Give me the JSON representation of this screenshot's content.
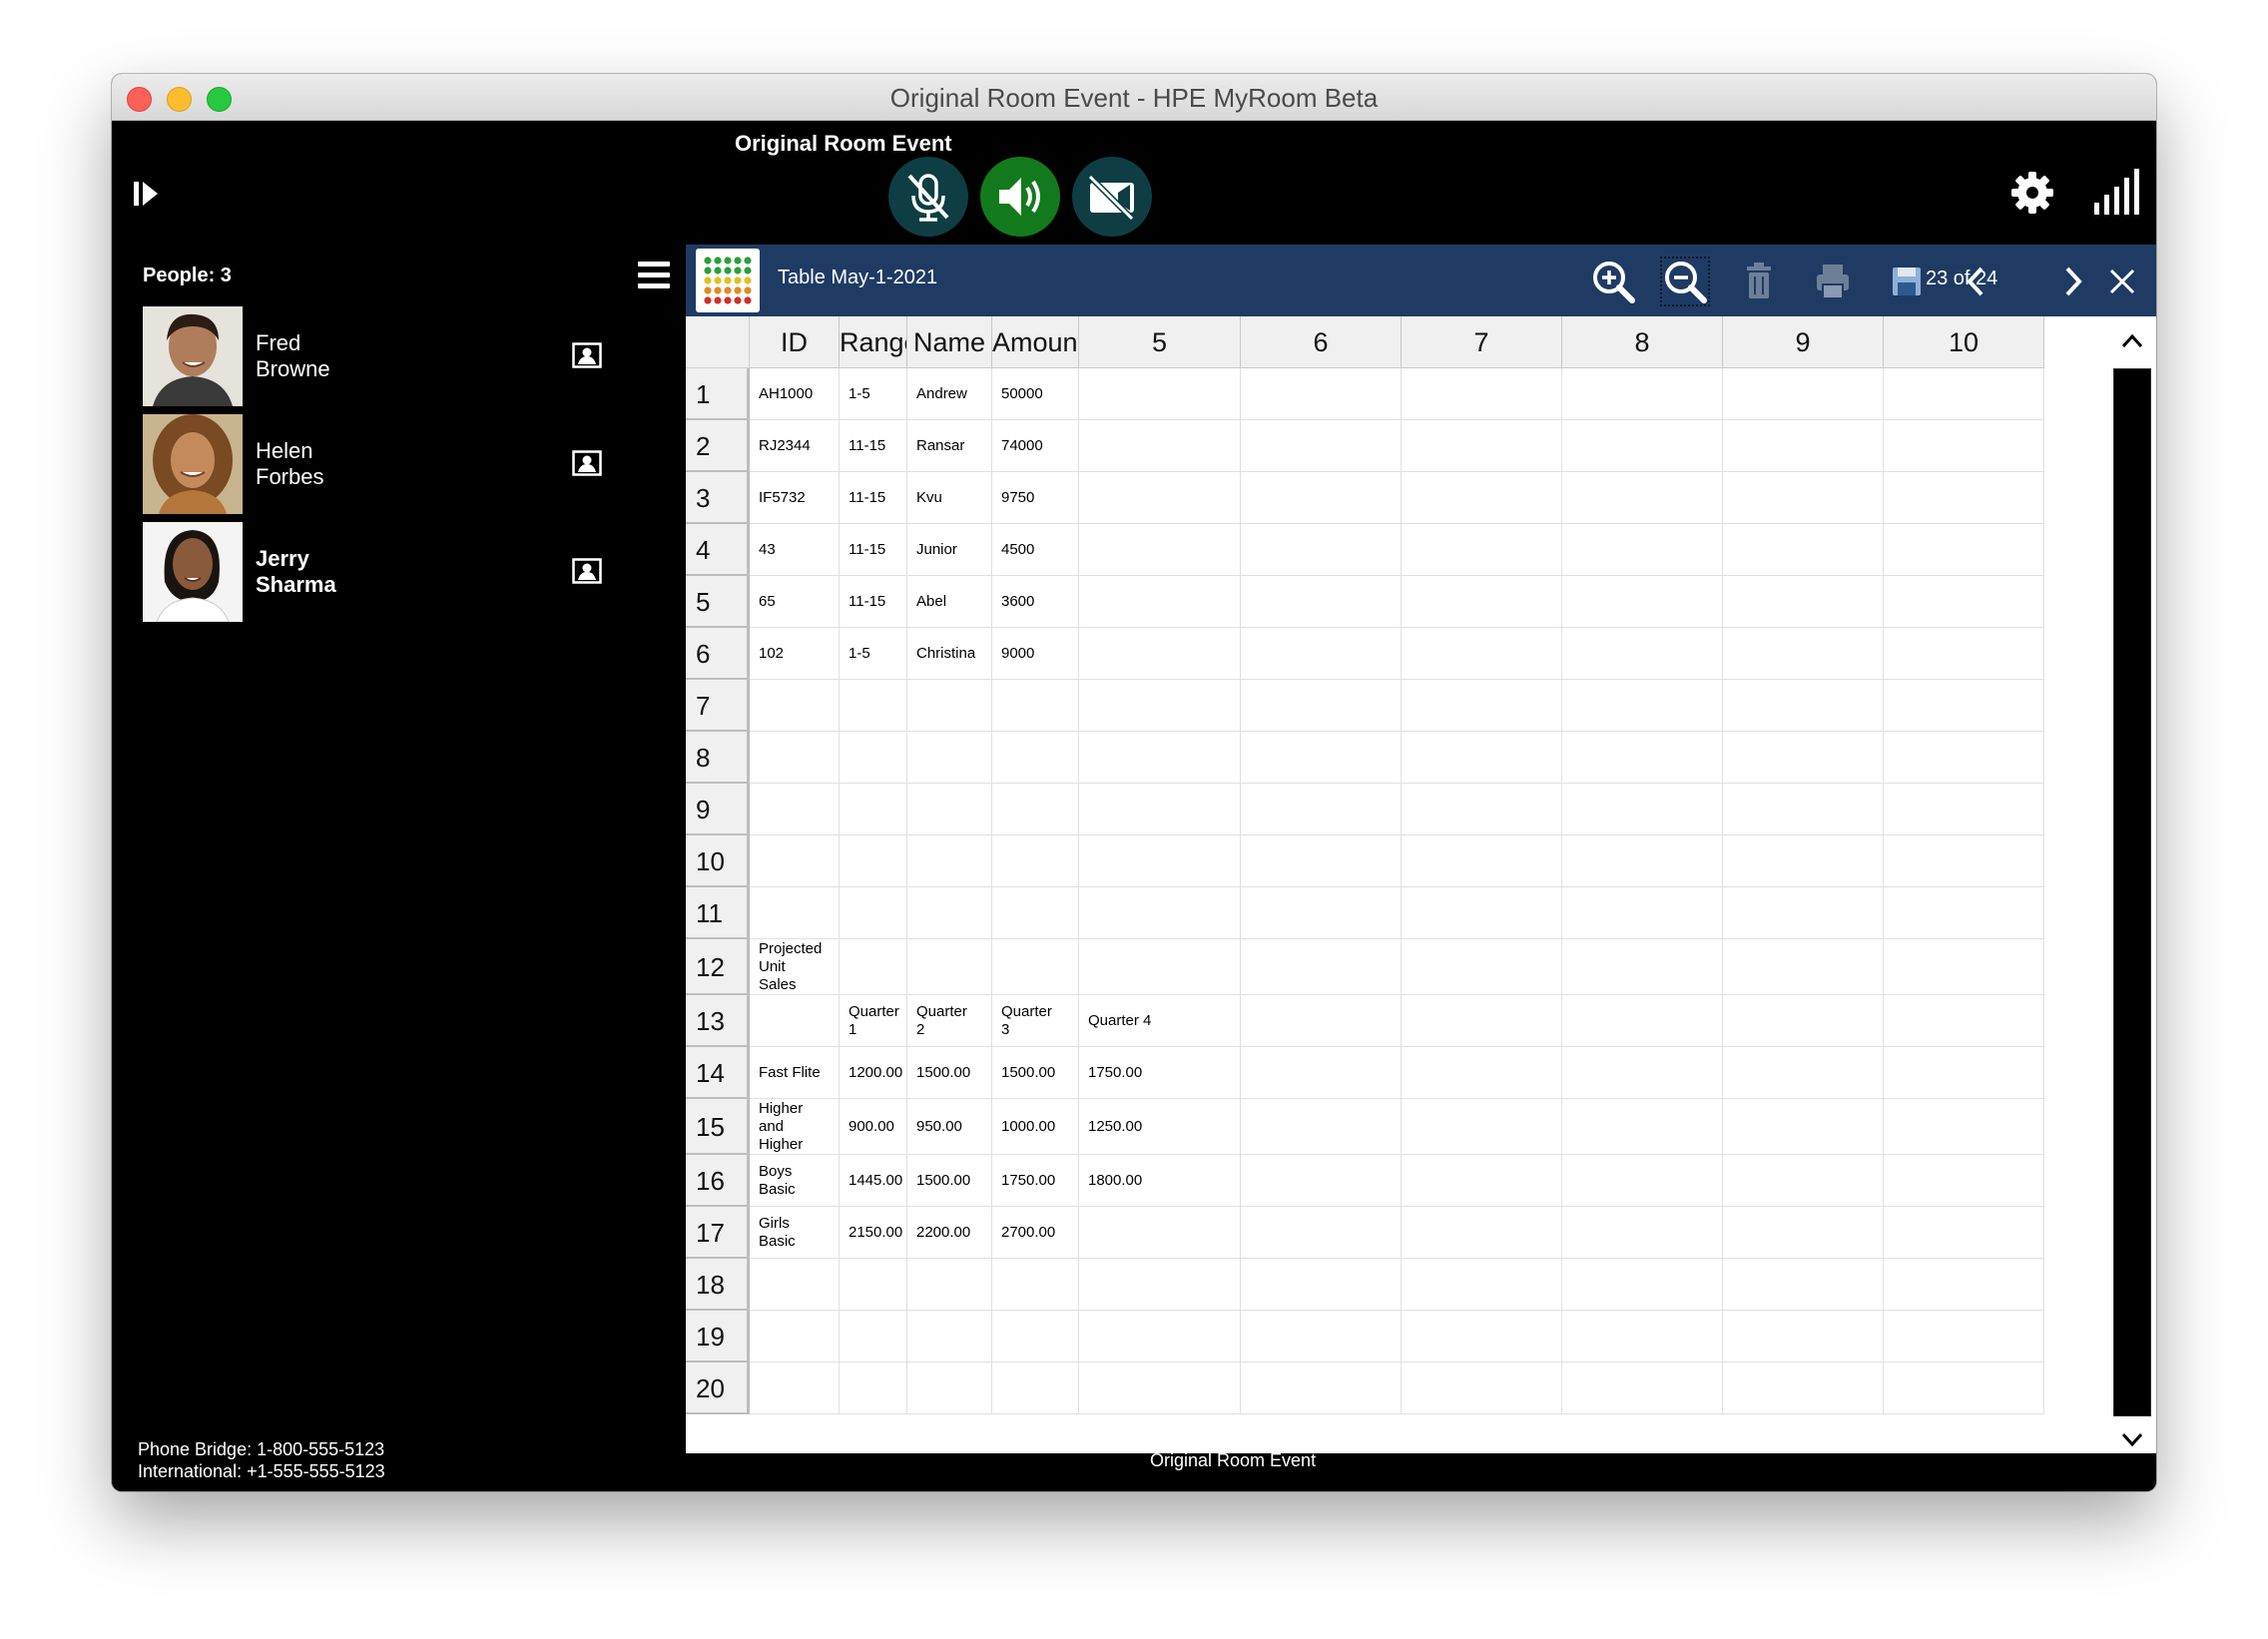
{
  "window": {
    "title": "Original Room Event - HPE MyRoom Beta"
  },
  "header": {
    "event_title": "Original Room Event"
  },
  "people": {
    "count_label": "People: 3",
    "list": [
      {
        "name": "Fred\nBrowne",
        "bold": false
      },
      {
        "name": "Helen\nForbes",
        "bold": false
      },
      {
        "name": "Jerry\nSharma",
        "bold": true
      }
    ]
  },
  "footer": {
    "phone_bridge": "Phone Bridge: 1-800-555-5123",
    "international": "International: +1-555-555-5123",
    "event_title": "Original Room Event"
  },
  "document": {
    "name": "Table May-1-2021",
    "page_indicator": "23 of 24"
  },
  "sheet": {
    "column_headers": [
      "ID",
      "Range",
      "Name",
      "Amount",
      "5",
      "6",
      "7",
      "8",
      "9",
      "10"
    ],
    "row_headers": [
      "1",
      "2",
      "3",
      "4",
      "5",
      "6",
      "7",
      "8",
      "9",
      "10",
      "11",
      "12",
      "13",
      "14",
      "15",
      "16",
      "17",
      "18",
      "19",
      "20"
    ],
    "rows": [
      [
        "AH1000",
        "1-5",
        "Andrew",
        "50000",
        "",
        "",
        "",
        "",
        "",
        ""
      ],
      [
        "RJ2344",
        "11-15",
        "Ransar",
        "74000",
        "",
        "",
        "",
        "",
        "",
        ""
      ],
      [
        "IF5732",
        "11-15",
        "Kvu",
        "9750",
        "",
        "",
        "",
        "",
        "",
        ""
      ],
      [
        "43",
        "11-15",
        "Junior",
        "4500",
        "",
        "",
        "",
        "",
        "",
        ""
      ],
      [
        "65",
        "11-15",
        "Abel",
        "3600",
        "",
        "",
        "",
        "",
        "",
        ""
      ],
      [
        "102",
        "1-5",
        "Christina",
        "9000",
        "",
        "",
        "",
        "",
        "",
        ""
      ],
      [
        "",
        "",
        "",
        "",
        "",
        "",
        "",
        "",
        "",
        ""
      ],
      [
        "",
        "",
        "",
        "",
        "",
        "",
        "",
        "",
        "",
        ""
      ],
      [
        "",
        "",
        "",
        "",
        "",
        "",
        "",
        "",
        "",
        ""
      ],
      [
        "",
        "",
        "",
        "",
        "",
        "",
        "",
        "",
        "",
        ""
      ],
      [
        "",
        "",
        "",
        "",
        "",
        "",
        "",
        "",
        "",
        ""
      ],
      [
        "Projected\nUnit\nSales",
        "",
        "",
        "",
        "",
        "",
        "",
        "",
        "",
        ""
      ],
      [
        "",
        "Quarter\n1",
        "Quarter\n2",
        "Quarter\n3",
        "Quarter 4",
        "",
        "",
        "",
        "",
        ""
      ],
      [
        "Fast Flite",
        "1200.00",
        "1500.00",
        "1500.00",
        "1750.00",
        "",
        "",
        "",
        "",
        ""
      ],
      [
        "Higher\nand\nHigher",
        "900.00",
        "950.00",
        "1000.00",
        "1250.00",
        "",
        "",
        "",
        "",
        ""
      ],
      [
        "Boys\nBasic",
        "1445.00",
        "1500.00",
        "1750.00",
        "1800.00",
        "",
        "",
        "",
        "",
        ""
      ],
      [
        "Girls\nBasic",
        "2150.00",
        "2200.00",
        "2700.00",
        "",
        "",
        "",
        "",
        "",
        ""
      ],
      [
        "",
        "",
        "",
        "",
        "",
        "",
        "",
        "",
        "",
        ""
      ],
      [
        "",
        "",
        "",
        "",
        "",
        "",
        "",
        "",
        "",
        ""
      ],
      [
        "",
        "",
        "",
        "",
        "",
        "",
        "",
        "",
        "",
        ""
      ]
    ]
  },
  "icons": {
    "sidebar_toggle": "sidebar-expand-icon",
    "mic": "mic-muted-icon",
    "speaker": "speaker-on-icon",
    "camera": "camera-off-icon",
    "settings": "gear-icon",
    "signal": "signal-strength-icon",
    "menu": "hamburger-menu-icon",
    "zoom_in": "zoom-in-icon",
    "zoom_out": "zoom-out-icon",
    "delete": "trash-icon",
    "print": "printer-icon",
    "save": "floppy-disk-icon",
    "prev": "chevron-left-icon",
    "next": "chevron-right-icon",
    "close": "close-icon"
  },
  "colors": {
    "app_background": "#000000",
    "toolbar": "#1f3b64",
    "speaker_active": "#127a1c",
    "control_muted": "#0e3d44"
  }
}
